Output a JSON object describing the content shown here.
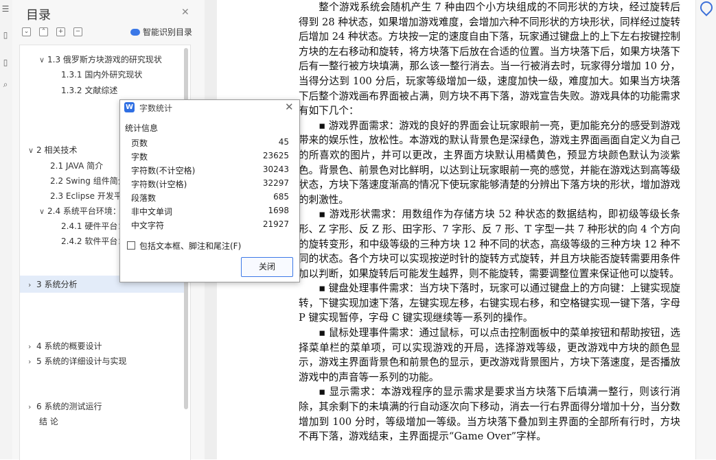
{
  "toc": {
    "title": "目录",
    "smart_label": "智能识别目录",
    "items": [
      {
        "text": "1.3 俄罗斯方块游戏的研究现状",
        "chev": "∨"
      },
      {
        "text": "1.3.1  国内外研究现状",
        "chev": ""
      },
      {
        "text": "1.3.2  文献综述",
        "chev": ""
      },
      {
        "text": "2 相关技术",
        "chev": "∨"
      },
      {
        "text": "2.1 JAVA 简介",
        "chev": ""
      },
      {
        "text": "2.2 Swing 组件简介",
        "chev": ""
      },
      {
        "text": "2.3 Eclipse 开发平台",
        "chev": ""
      },
      {
        "text": "2.4 系统平台环境：",
        "chev": "∨"
      },
      {
        "text": "2.4.1  硬件平台：",
        "chev": ""
      },
      {
        "text": "2.4.2  软件平台：",
        "chev": ""
      },
      {
        "text": "3    系统分析",
        "chev": "›"
      },
      {
        "text": "4    系统的概要设计",
        "chev": "›"
      },
      {
        "text": "5    系统的详细设计与实现",
        "chev": "›"
      },
      {
        "text": "6  系统的测试运行",
        "chev": "›"
      },
      {
        "text": "结    论",
        "chev": ""
      }
    ]
  },
  "dialog": {
    "title": "字数统计",
    "section": "统计信息",
    "stats": [
      {
        "label": "页数",
        "value": "45"
      },
      {
        "label": "字数",
        "value": "23625"
      },
      {
        "label": "字符数(不计空格)",
        "value": "30243"
      },
      {
        "label": "字符数(计空格)",
        "value": "32297"
      },
      {
        "label": "段落数",
        "value": "685"
      },
      {
        "label": "非中文单词",
        "value": "1698"
      },
      {
        "label": "中文字符",
        "value": "21927"
      }
    ],
    "checkbox_label": "包括文本框、脚注和尾注(F)",
    "close_label": "关闭"
  },
  "document": {
    "paragraphs": [
      "整个游戏系统会随机产生 7 种由四个小方块组成的不同形状的方块，经过旋转后得到 28 种状态，如果增加游戏难度，会增加六种不同形状的方块形状，同样经过旋转后增加 24 种状态。方块按一定的速度自由下落，玩家通过键盘上的上下左右按键控制方块的左右移动和旋转，将方块落下后放在合适的位置。当方块落下后，如果方块落下后有一整行被方块填满，那么该一整行消去。当一行被消去时，玩家得分增加 10 分，当得分达到 100 分后，玩家等级增加一级，速度加快一级，难度加大。如果当方块落下后整个游戏画布界面被占满，则方块不再下落，游戏宣告失败。游戏具体的功能需求有如下几个：",
      "▪ 游戏界面需求：游戏的良好的界面会让玩家眼前一亮，更加能充分的感受到游戏带来的娱乐性，放松性。本游戏的默认背景色是深绿色，游戏主界面画面自定义为自己的所喜欢的图片，并可以更改，主界面方块默认用橘黄色，预显方块颜色默认为淡紫色。背景色、前景色对比鲜明，以达到让玩家眼前一亮的感觉，并能在游戏达到高等级状态，方块下落速度渐高的情况下使玩家能够清楚的分辨出下落方块的形状，增加游戏的刺激性。",
      "▪ 游戏形状需求：用数组作为存储方块 52 种状态的数据结构，即初级等级长条形、Z 字形、反 Z 形、田字形、7 字形、反 7 形、T 字型一共 7 种形状的向 4 个方向的旋转变形，和中级等级的三种方块 12 种不同的状态，高级等级的三种方块 12 种不同的状态。各个方块可以实现按逆时针的旋转方式旋转，并且方块能否旋转需要用条件加以判断，如果旋转后可能发生越界，则不能旋转，需要调整位置来保证他可以旋转。",
      "▪ 键盘处理事件需求：当方块下落时，玩家可以通过键盘上的方向键：上键实现旋转，下键实现加速下落，左键实现左移，右键实现右移，和空格键实现一键下落，字母 P 键实现暂停，字母 C 键实现继续等一系列的操作。",
      "▪ 鼠标处理事件需求：通过鼠标，可以点击控制面板中的菜单按钮和帮助按钮，选择菜单栏的菜单项，可以实现游戏的开局，选择游戏等级，更改游戏中方块的颜色显示，游戏主界面背景色和前景色的显示，更改游戏背景图片，方块下落速度，是否播放游戏中的声音等一系列的功能。",
      "▪ 显示需求：本游戏程序的显示需求是要求当方块落下后填满一整行，则该行消除，其余剩下的未填满的行自动逐次向下移动，消去一行右界面得分增加十分，当分数增加到 100 分时，等级增加一等级。当方块落下叠加到主界面的全部所有行时，方块不再下落，游戏结束，主界面提示“Game Over”字样。"
    ]
  }
}
